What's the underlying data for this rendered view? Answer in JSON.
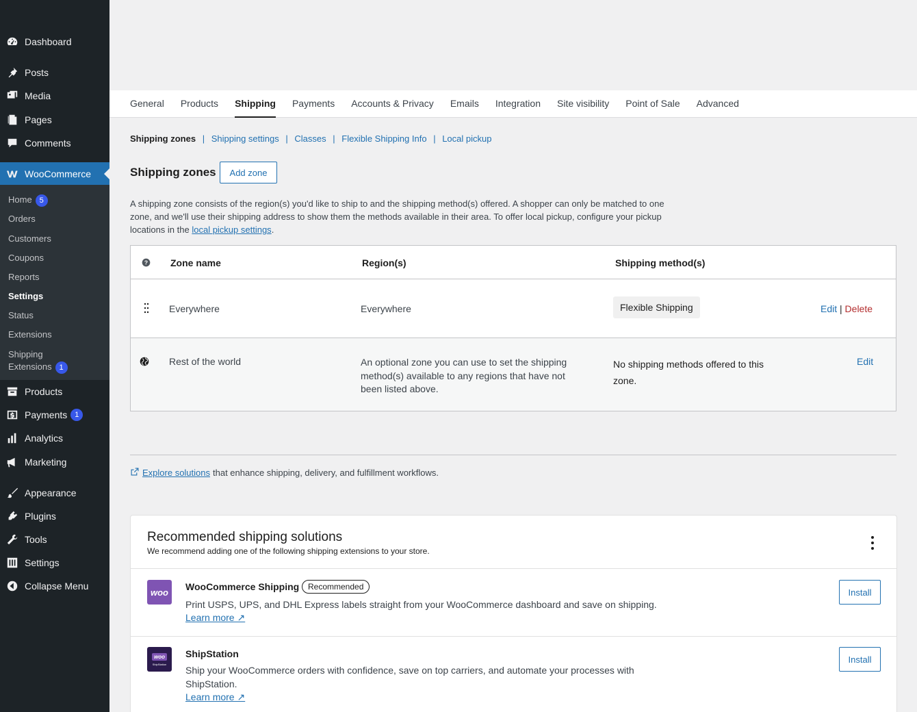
{
  "sidebar": {
    "top_items": [
      {
        "label": "Dashboard",
        "icon": "dashboard-icon"
      },
      {
        "label": "Posts",
        "icon": "pin-icon"
      },
      {
        "label": "Media",
        "icon": "media-icon"
      },
      {
        "label": "Pages",
        "icon": "pages-icon"
      },
      {
        "label": "Comments",
        "icon": "comment-icon"
      }
    ],
    "woocommerce": "WooCommerce",
    "sub_items": [
      {
        "label": "Home",
        "badge": "5"
      },
      {
        "label": "Orders"
      },
      {
        "label": "Customers"
      },
      {
        "label": "Coupons"
      },
      {
        "label": "Reports"
      },
      {
        "label": "Settings"
      },
      {
        "label": "Status"
      },
      {
        "label": "Extensions"
      },
      {
        "label_line1": "Shipping",
        "label_line2": "Extensions",
        "badge": "1"
      }
    ],
    "bottom_items": [
      {
        "label": "Products"
      },
      {
        "label": "Payments",
        "badge": "1"
      },
      {
        "label": "Analytics"
      },
      {
        "label": "Marketing"
      },
      {
        "label": "Appearance"
      },
      {
        "label": "Plugins"
      },
      {
        "label": "Tools"
      },
      {
        "label": "Settings"
      },
      {
        "label": "Collapse Menu"
      }
    ]
  },
  "tabs": [
    "General",
    "Products",
    "Shipping",
    "Payments",
    "Accounts & Privacy",
    "Emails",
    "Integration",
    "Site visibility",
    "Point of Sale",
    "Advanced"
  ],
  "active_tab": "Shipping",
  "subsub": {
    "current": "Shipping zones",
    "links": [
      "Shipping settings",
      "Classes",
      "Flexible Shipping Info",
      "Local pickup"
    ]
  },
  "zones": {
    "title": "Shipping zones",
    "add_button": "Add zone",
    "desc_part1": "A shipping zone consists of the region(s) you'd like to ship to and the shipping method(s) offered. A shopper can only be matched to one zone, and we'll use their shipping address to show them the methods available in their area. To offer local pickup, configure your pickup locations in the ",
    "desc_link": "local pickup settings",
    "desc_end": ".",
    "headers": {
      "zone": "Zone name",
      "regions": "Region(s)",
      "methods": "Shipping method(s)"
    },
    "row1": {
      "zone": "Everywhere",
      "region": "Everywhere",
      "method": "Flexible Shipping",
      "edit": "Edit",
      "sep": "|",
      "delete": "Delete"
    },
    "row2": {
      "zone": "Rest of the world",
      "region": "An optional zone you can use to set the shipping method(s) available to any regions that have not been listed above.",
      "method": "No shipping methods offered to this zone.",
      "edit": "Edit"
    }
  },
  "explore": {
    "link": "Explore solutions",
    "text": "that enhance shipping, delivery, and fulfillment workflows."
  },
  "recommended": {
    "title": "Recommended shipping solutions",
    "subtitle": "We recommend adding one of the following shipping extensions to your store.",
    "items": [
      {
        "name": "WooCommerce Shipping",
        "badge": "Recommended",
        "desc": "Print USPS, UPS, and DHL Express labels straight from your WooCommerce dashboard and save on shipping.",
        "learn": "Learn more ↗",
        "install": "Install",
        "logo_text": "woo"
      },
      {
        "name": "ShipStation",
        "desc": "Ship your WooCommerce orders with confidence, save on top carriers, and automate your processes with ShipStation.",
        "learn": "Learn more ↗",
        "install": "Install",
        "logo_text": "woo",
        "logo_subtext": "ShipStation"
      }
    ]
  },
  "colors": {
    "sidebar_bg": "#1d2327",
    "accent": "#2271b1",
    "active_menu": "#2271b1",
    "delete": "#b32d2e",
    "woo_purple": "#7f54b3"
  }
}
